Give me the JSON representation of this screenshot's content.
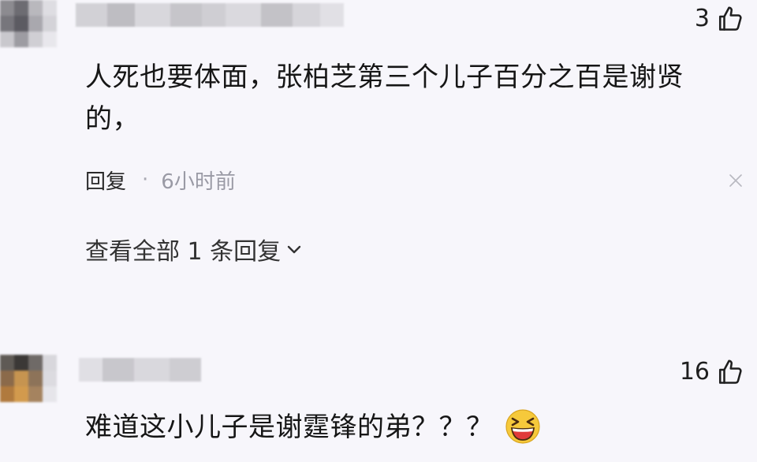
{
  "colors": {
    "background": "#f7f6fb",
    "text": "#161616",
    "muted": "#9a9aa5",
    "emoji_yellow": "#f6c93b",
    "emoji_red": "#e03a3a"
  },
  "comments": [
    {
      "like_count": "3",
      "like_icon": "thumbs-up-icon",
      "text": "人死也要体面，张柏芝第三个儿子百分之百是谢贤的，",
      "reply_label": "回复",
      "separator": "·",
      "time": "6小时前",
      "close_icon": "close-icon",
      "view_all_replies": "查看全部 1 条回复",
      "chevron_icon": "chevron-down-icon"
    },
    {
      "like_count": "16",
      "like_icon": "thumbs-up-icon",
      "text": "难道这小儿子是谢霆锋的弟？？？",
      "emoji_icon": "grinning-squinting-face-icon"
    }
  ]
}
